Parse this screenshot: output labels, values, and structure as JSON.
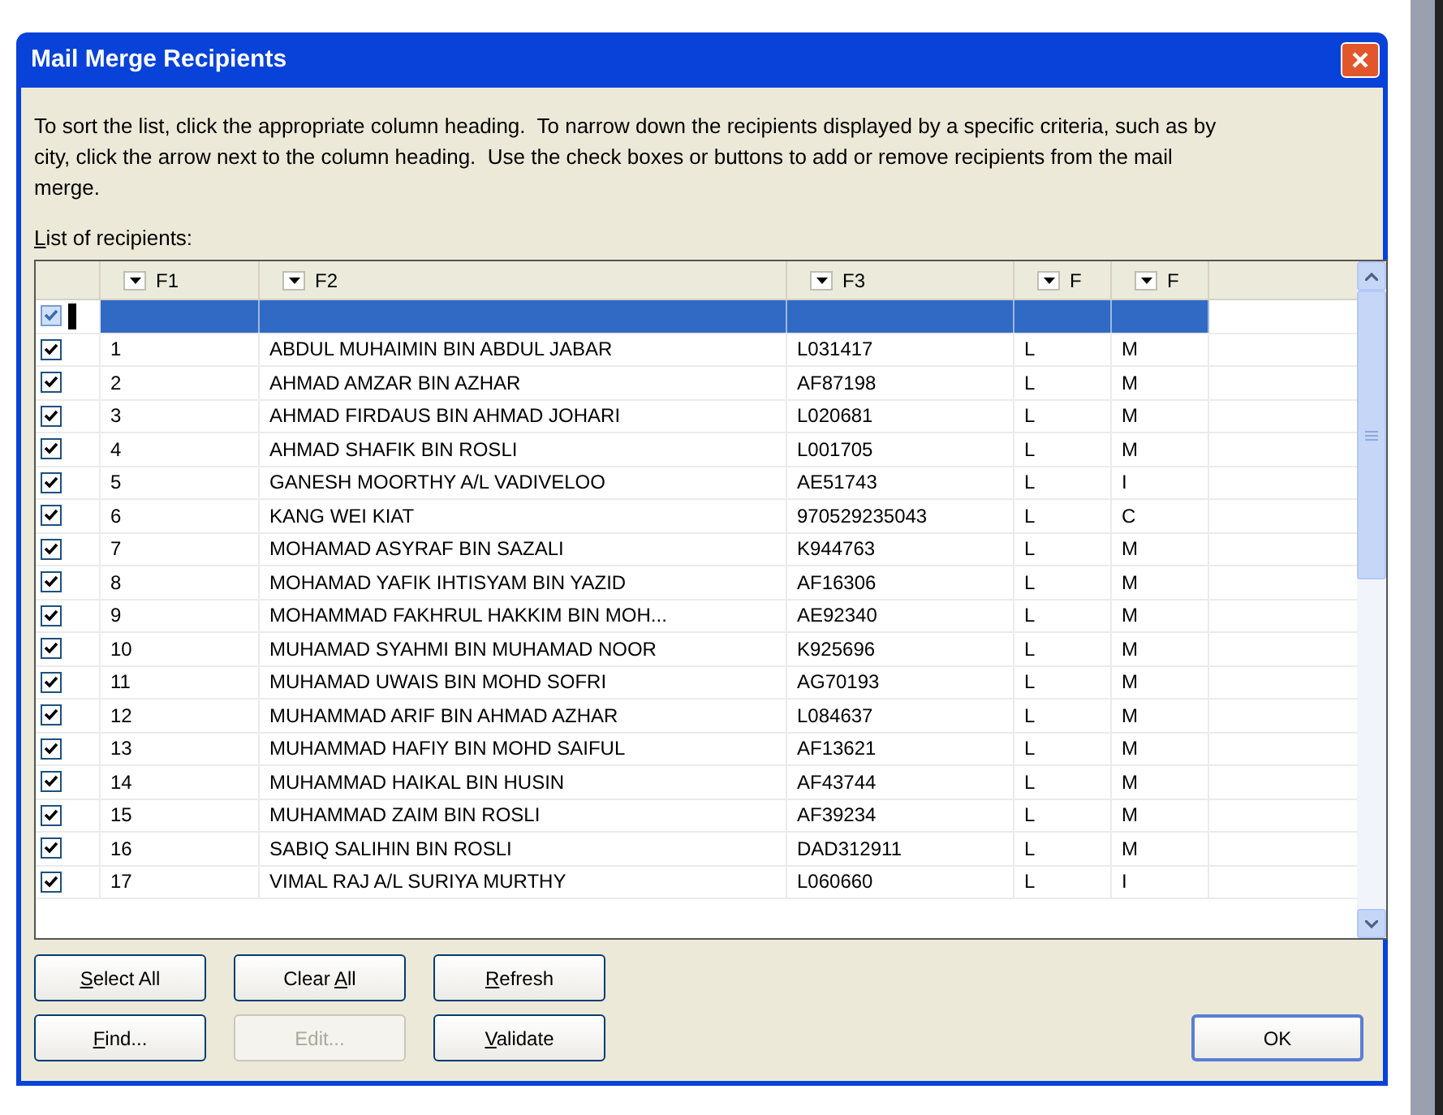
{
  "window": {
    "title": "Mail Merge Recipients"
  },
  "instructions": "To sort the list, click the appropriate column heading.  To narrow down the recipients displayed by a specific criteria, such as by city, click the arrow next to the column heading.  Use the check boxes or buttons to add or remove recipients from the mail merge.",
  "list_label": {
    "parts": [
      {
        "text": "L",
        "underlined": true
      },
      {
        "text": "ist of recipients:",
        "underlined": false
      }
    ]
  },
  "table": {
    "columns": [
      "F1",
      "F2",
      "F3",
      "F",
      "F"
    ],
    "rows": [
      {
        "checked": true,
        "selected": true,
        "cells": []
      },
      {
        "checked": true,
        "selected": false,
        "cells": [
          "1",
          "ABDUL MUHAIMIN BIN ABDUL JABAR",
          "L031417",
          "L",
          "M"
        ]
      },
      {
        "checked": true,
        "selected": false,
        "cells": [
          "2",
          "AHMAD AMZAR BIN AZHAR",
          "AF87198",
          "L",
          "M"
        ]
      },
      {
        "checked": true,
        "selected": false,
        "cells": [
          "3",
          "AHMAD FIRDAUS BIN AHMAD JOHARI",
          "L020681",
          "L",
          "M"
        ]
      },
      {
        "checked": true,
        "selected": false,
        "cells": [
          "4",
          "AHMAD SHAFIK BIN ROSLI",
          "L001705",
          "L",
          "M"
        ]
      },
      {
        "checked": true,
        "selected": false,
        "cells": [
          "5",
          "GANESH MOORTHY A/L VADIVELOO",
          "AE51743",
          "L",
          "I"
        ]
      },
      {
        "checked": true,
        "selected": false,
        "cells": [
          "6",
          "KANG WEI KIAT",
          "970529235043",
          "L",
          "C"
        ]
      },
      {
        "checked": true,
        "selected": false,
        "cells": [
          "7",
          "MOHAMAD ASYRAF BIN SAZALI",
          "K944763",
          "L",
          "M"
        ]
      },
      {
        "checked": true,
        "selected": false,
        "cells": [
          "8",
          "MOHAMAD YAFIK IHTISYAM BIN YAZID",
          "AF16306",
          "L",
          "M"
        ]
      },
      {
        "checked": true,
        "selected": false,
        "cells": [
          "9",
          "MOHAMMAD FAKHRUL HAKKIM BIN MOH...",
          "AE92340",
          "L",
          "M"
        ]
      },
      {
        "checked": true,
        "selected": false,
        "cells": [
          "10",
          "MUHAMAD SYAHMI BIN MUHAMAD NOOR",
          "K925696",
          "L",
          "M"
        ]
      },
      {
        "checked": true,
        "selected": false,
        "cells": [
          "11",
          "MUHAMAD UWAIS BIN MOHD SOFRI",
          "AG70193",
          "L",
          "M"
        ]
      },
      {
        "checked": true,
        "selected": false,
        "cells": [
          "12",
          "MUHAMMAD ARIF BIN AHMAD AZHAR",
          "L084637",
          "L",
          "M"
        ]
      },
      {
        "checked": true,
        "selected": false,
        "cells": [
          "13",
          "MUHAMMAD HAFIY BIN MOHD SAIFUL",
          "AF13621",
          "L",
          "M"
        ]
      },
      {
        "checked": true,
        "selected": false,
        "cells": [
          "14",
          "MUHAMMAD HAIKAL BIN HUSIN",
          "AF43744",
          "L",
          "M"
        ]
      },
      {
        "checked": true,
        "selected": false,
        "cells": [
          "15",
          "MUHAMMAD ZAIM BIN ROSLI",
          "AF39234",
          "L",
          "M"
        ]
      },
      {
        "checked": true,
        "selected": false,
        "cells": [
          "16",
          "SABIQ SALIHIN BIN ROSLI",
          "DAD312911",
          "L",
          "M"
        ]
      },
      {
        "checked": true,
        "selected": false,
        "cells": [
          "17",
          "VIMAL RAJ A/L SURIYA MURTHY",
          "L060660",
          "L",
          "I"
        ]
      }
    ]
  },
  "buttons": [
    {
      "label": [
        {
          "text": "S",
          "underlined": true
        },
        {
          "text": "elect All",
          "underlined": false
        }
      ],
      "disabled": false
    },
    {
      "label": [
        {
          "text": "Clear ",
          "underlined": false
        },
        {
          "text": "A",
          "underlined": true
        },
        {
          "text": "ll",
          "underlined": false
        }
      ],
      "disabled": false
    },
    {
      "label": [
        {
          "text": "R",
          "underlined": true
        },
        {
          "text": "efresh",
          "underlined": false
        }
      ],
      "disabled": false
    },
    {
      "label": [
        {
          "text": "F",
          "underlined": true
        },
        {
          "text": "ind...",
          "underlined": false
        }
      ],
      "disabled": false
    },
    {
      "label": [
        {
          "text": "Edit...",
          "underlined": false
        }
      ],
      "disabled": true
    },
    {
      "label": [
        {
          "text": "V",
          "underlined": true
        },
        {
          "text": "alidate",
          "underlined": false
        }
      ],
      "disabled": false
    }
  ],
  "ok_button": {
    "label": "OK"
  }
}
